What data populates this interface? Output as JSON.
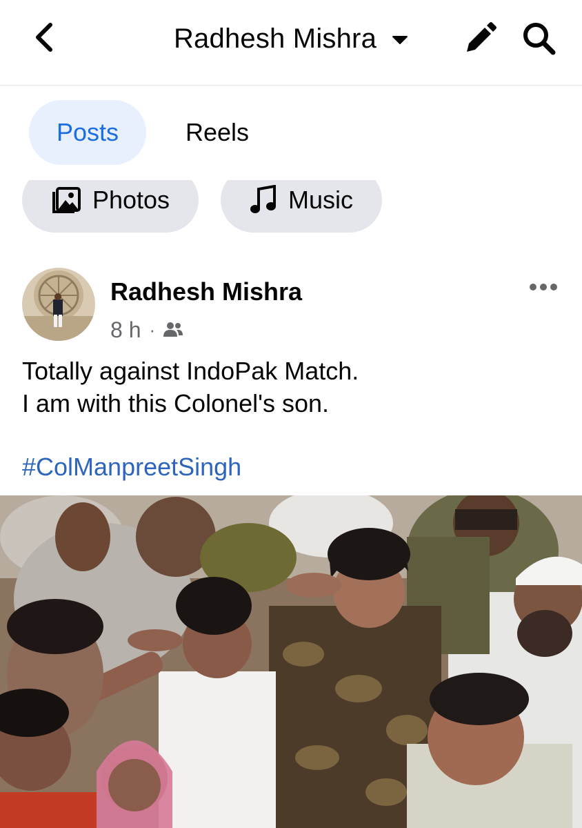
{
  "header": {
    "title": "Radhesh Mishra",
    "icons": {
      "back": "chevron-left-icon",
      "caret": "caret-down-icon",
      "edit": "pencil-icon",
      "search": "search-icon"
    }
  },
  "tabs": [
    {
      "label": "Posts",
      "selected": true
    },
    {
      "label": "Reels",
      "selected": false
    }
  ],
  "chips": [
    {
      "label": "Photos",
      "icon": "photos-icon"
    },
    {
      "label": "Music",
      "icon": "music-note-icon"
    }
  ],
  "post": {
    "author": "Radhesh Mishra",
    "time": "8 h",
    "separator": "·",
    "audience_icon": "friends-icon",
    "text_lines": [
      "Totally against IndoPak Match.",
      "I am with this Colonel's son."
    ],
    "hashtag": "#ColManpreetSingh",
    "colors": {
      "link": "#2d64bc",
      "meta": "#65676b",
      "tab_active_bg": "#e7f0fc",
      "tab_active_text": "#1a6ee0",
      "chip_bg": "#e4e6eb"
    }
  }
}
